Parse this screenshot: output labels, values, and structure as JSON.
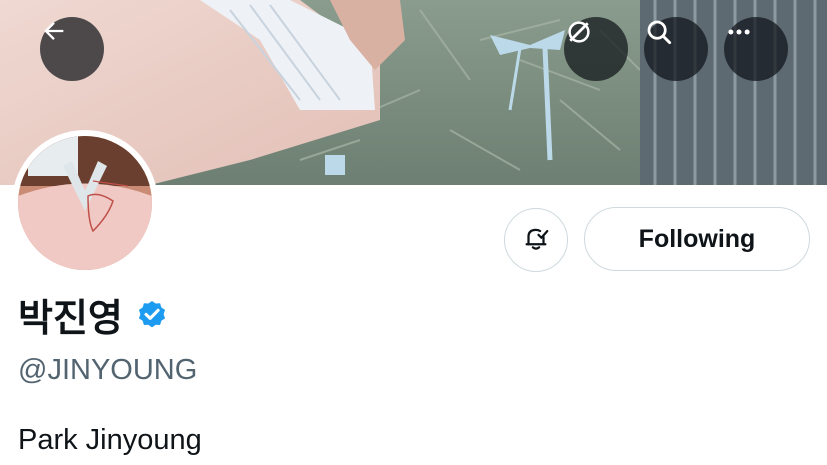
{
  "header": {
    "back_icon": "arrow-left-icon",
    "grok_icon": "grok-icon",
    "search_icon": "search-icon",
    "more_icon": "more-horizontal-icon"
  },
  "profile": {
    "display_name": "박진영",
    "verified_icon": "verified-badge-icon",
    "handle": "@JINYOUNG",
    "bio": "Park Jinyoung",
    "notification_icon": "bell-check-icon",
    "follow_button_label": "Following"
  },
  "colors": {
    "verified_blue": "#1d9bf0",
    "handle_gray": "#536471",
    "button_border": "#cfd9de"
  }
}
